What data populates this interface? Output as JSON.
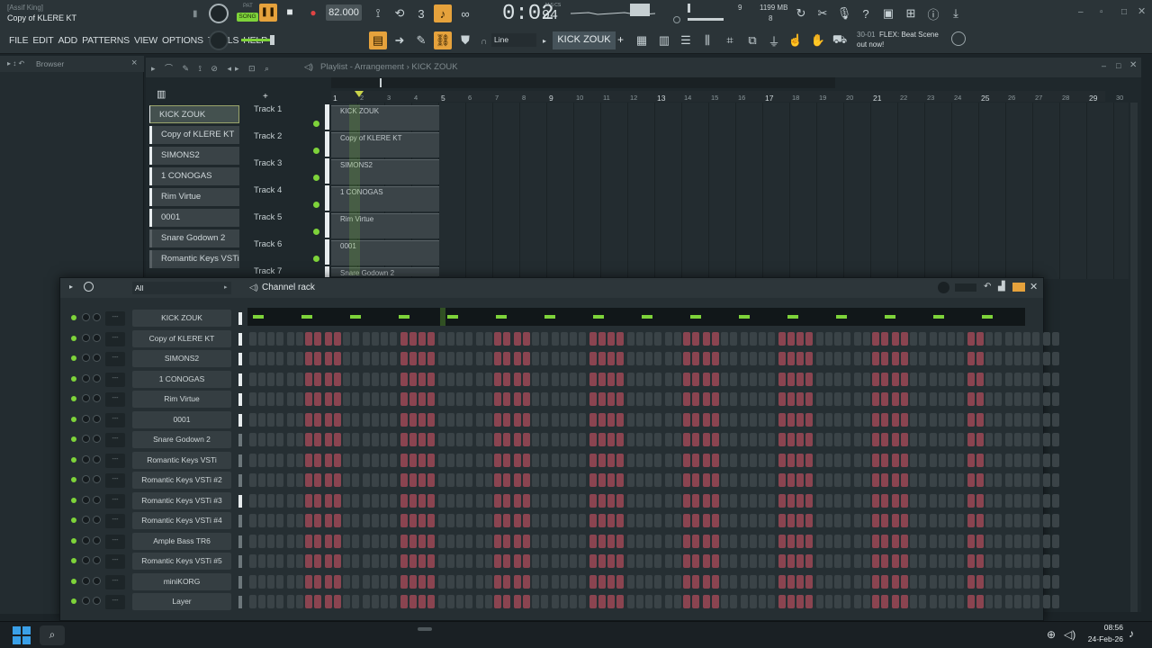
{
  "title_bar": {
    "user": "[Assif King]",
    "project": "Copy of KLERE KT"
  },
  "transport": {
    "mode_label": "SONG",
    "pat_label": "PAT",
    "tempo": "82.000",
    "time_main": "0:02",
    "time_sub": "94",
    "time_unit": "M:S:CS",
    "meter_number": "9",
    "memory": "1199 MB",
    "cpu": "8"
  },
  "menu": [
    "FILE",
    "EDIT",
    "ADD",
    "PATTERNS",
    "VIEW",
    "OPTIONS",
    "TOOLS",
    "HELP"
  ],
  "toolbar2": {
    "snap_label": "Line",
    "pattern_selector": "KICK ZOUK",
    "pattern_add": "+"
  },
  "hint": {
    "code": "30-01",
    "line1": "FLEX: Beat Scene",
    "line2": "out now!"
  },
  "browser": {
    "title": "Browser"
  },
  "playlist": {
    "breadcrumb": "Playlist - Arrangement › KICK ZOUK",
    "patterns": [
      "KICK ZOUK",
      "Copy of KLERE KT",
      "SIMONS2",
      "1 CONOGAS",
      "Rim Virtue",
      "0001",
      "Snare Godown 2",
      "Romantic Keys VSTi"
    ],
    "tracks": [
      "Track 1",
      "Track 2",
      "Track 3",
      "Track 4",
      "Track 5",
      "Track 6",
      "Track 7"
    ],
    "clips": [
      "KICK ZOUK",
      "Copy of KLERE KT",
      "SIMONS2",
      "1 CONOGAS",
      "Rim Virtue",
      "0001",
      "Snare Godown 2"
    ],
    "ruler": [
      "1",
      "2",
      "3",
      "4",
      "5",
      "6",
      "7",
      "8",
      "9",
      "10",
      "11",
      "12",
      "13",
      "14",
      "15",
      "16",
      "17",
      "18",
      "19",
      "20",
      "21",
      "22",
      "23",
      "24",
      "25",
      "26",
      "27",
      "28",
      "29",
      "30"
    ]
  },
  "rack": {
    "title": "Channel rack",
    "filter": "All",
    "mixer_label": "---",
    "channels": [
      "KICK ZOUK",
      "Copy of KLERE KT",
      "SIMONS2",
      "1 CONOGAS",
      "Rim Virtue",
      "0001",
      "Snare Godown 2",
      "Romantic Keys VSTi",
      "Romantic Keys VSTi #2",
      "Romantic Keys VSTi #3",
      "Romantic Keys VSTi #4",
      "Ample Bass TR6",
      "Romantic Keys VSTi #5",
      "miniKORG",
      "Layer"
    ]
  },
  "taskbar": {
    "time": "08:56",
    "date": "24-Feb-26",
    "add": "+"
  },
  "colors": {
    "accent_orange": "#e6a23c",
    "led_green": "#7ed33a",
    "step_red": "#8a4450",
    "step_grey": "#3a4347"
  }
}
